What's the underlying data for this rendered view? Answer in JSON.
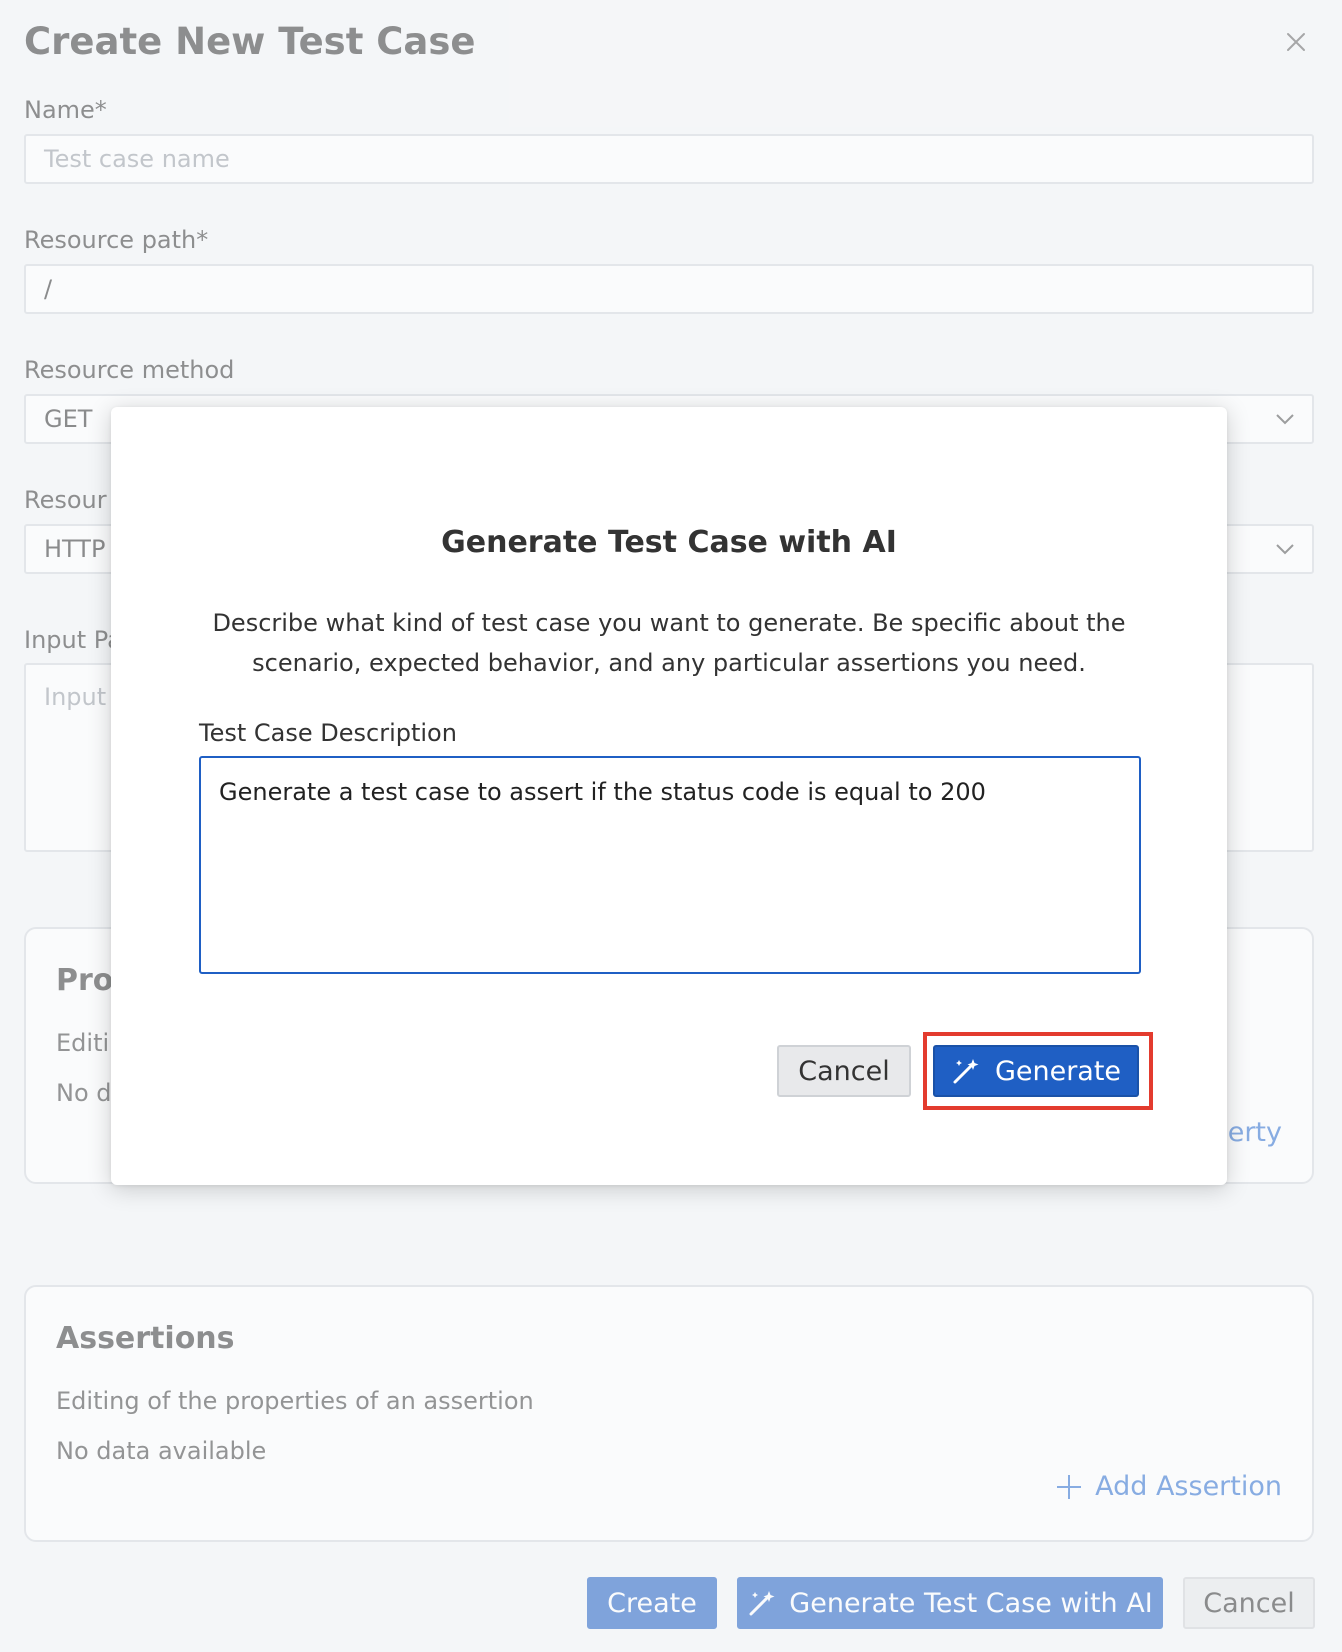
{
  "page": {
    "title": "Create New Test Case"
  },
  "form": {
    "name": {
      "label": "Name*",
      "placeholder": "Test case name",
      "value": ""
    },
    "resource_path": {
      "label": "Resource path*",
      "value": "/"
    },
    "resource_method": {
      "label": "Resource method",
      "value": "GET"
    },
    "resource_type": {
      "label": "Resour",
      "value": "HTTP"
    },
    "input_payload": {
      "label": "Input Pa",
      "placeholder": "Input"
    }
  },
  "properties_card": {
    "title": "Prop",
    "description": "Editi",
    "empty": "No d",
    "add_link": "erty"
  },
  "assertions_card": {
    "title": "Assertions",
    "description": "Editing of the properties of an assertion",
    "empty": "No data available",
    "add_link": "Add Assertion"
  },
  "footer": {
    "create_label": "Create",
    "generate_label": "Generate Test Case with AI",
    "cancel_label": "Cancel"
  },
  "modal": {
    "title": "Generate Test Case with AI",
    "description": "Describe what kind of test case you want to generate. Be specific about the scenario, expected behavior, and any particular assertions you need.",
    "field_label": "Test Case Description",
    "field_value": "Generate a test case to assert if the status code is equal to 200",
    "cancel_label": "Cancel",
    "generate_label": "Generate"
  },
  "colors": {
    "primary": "#1f5fc4",
    "highlight": "#e33b2e",
    "link": "#2f6fd0"
  },
  "icons": {
    "close": "close-icon",
    "chevron": "chevron-down-icon",
    "wand": "magic-wand-icon",
    "plus": "plus-icon"
  }
}
